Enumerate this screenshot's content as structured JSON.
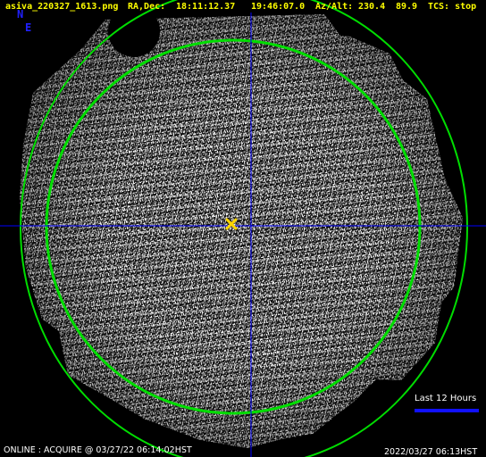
{
  "header": {
    "filename": "asiva_220327_1613.png",
    "radec_label": "RA,Dec:",
    "ra": "18:11:12.37",
    "dec": "19:46:07.0",
    "azalt_label": "Az/Alt:",
    "az": "230.4",
    "alt": "89.9",
    "tcs_status": "TCS: stop"
  },
  "compass": {
    "north": "N",
    "east": "E"
  },
  "history": {
    "label": "Last 12 Hours"
  },
  "status": {
    "line": "ONLINE : ACQUIRE @ 03/27/22 06:14:02HST",
    "timestamp": "2022/03/27 06:13HST"
  },
  "colors": {
    "header_text": "#ffff00",
    "compass": "#2020ff",
    "crosshair": "#0000ff",
    "elevation_circle": "#00dd00",
    "target_marker": "#ffd700",
    "history_bar": "#1010ff"
  },
  "icons": {
    "target": "x-mark-icon"
  }
}
